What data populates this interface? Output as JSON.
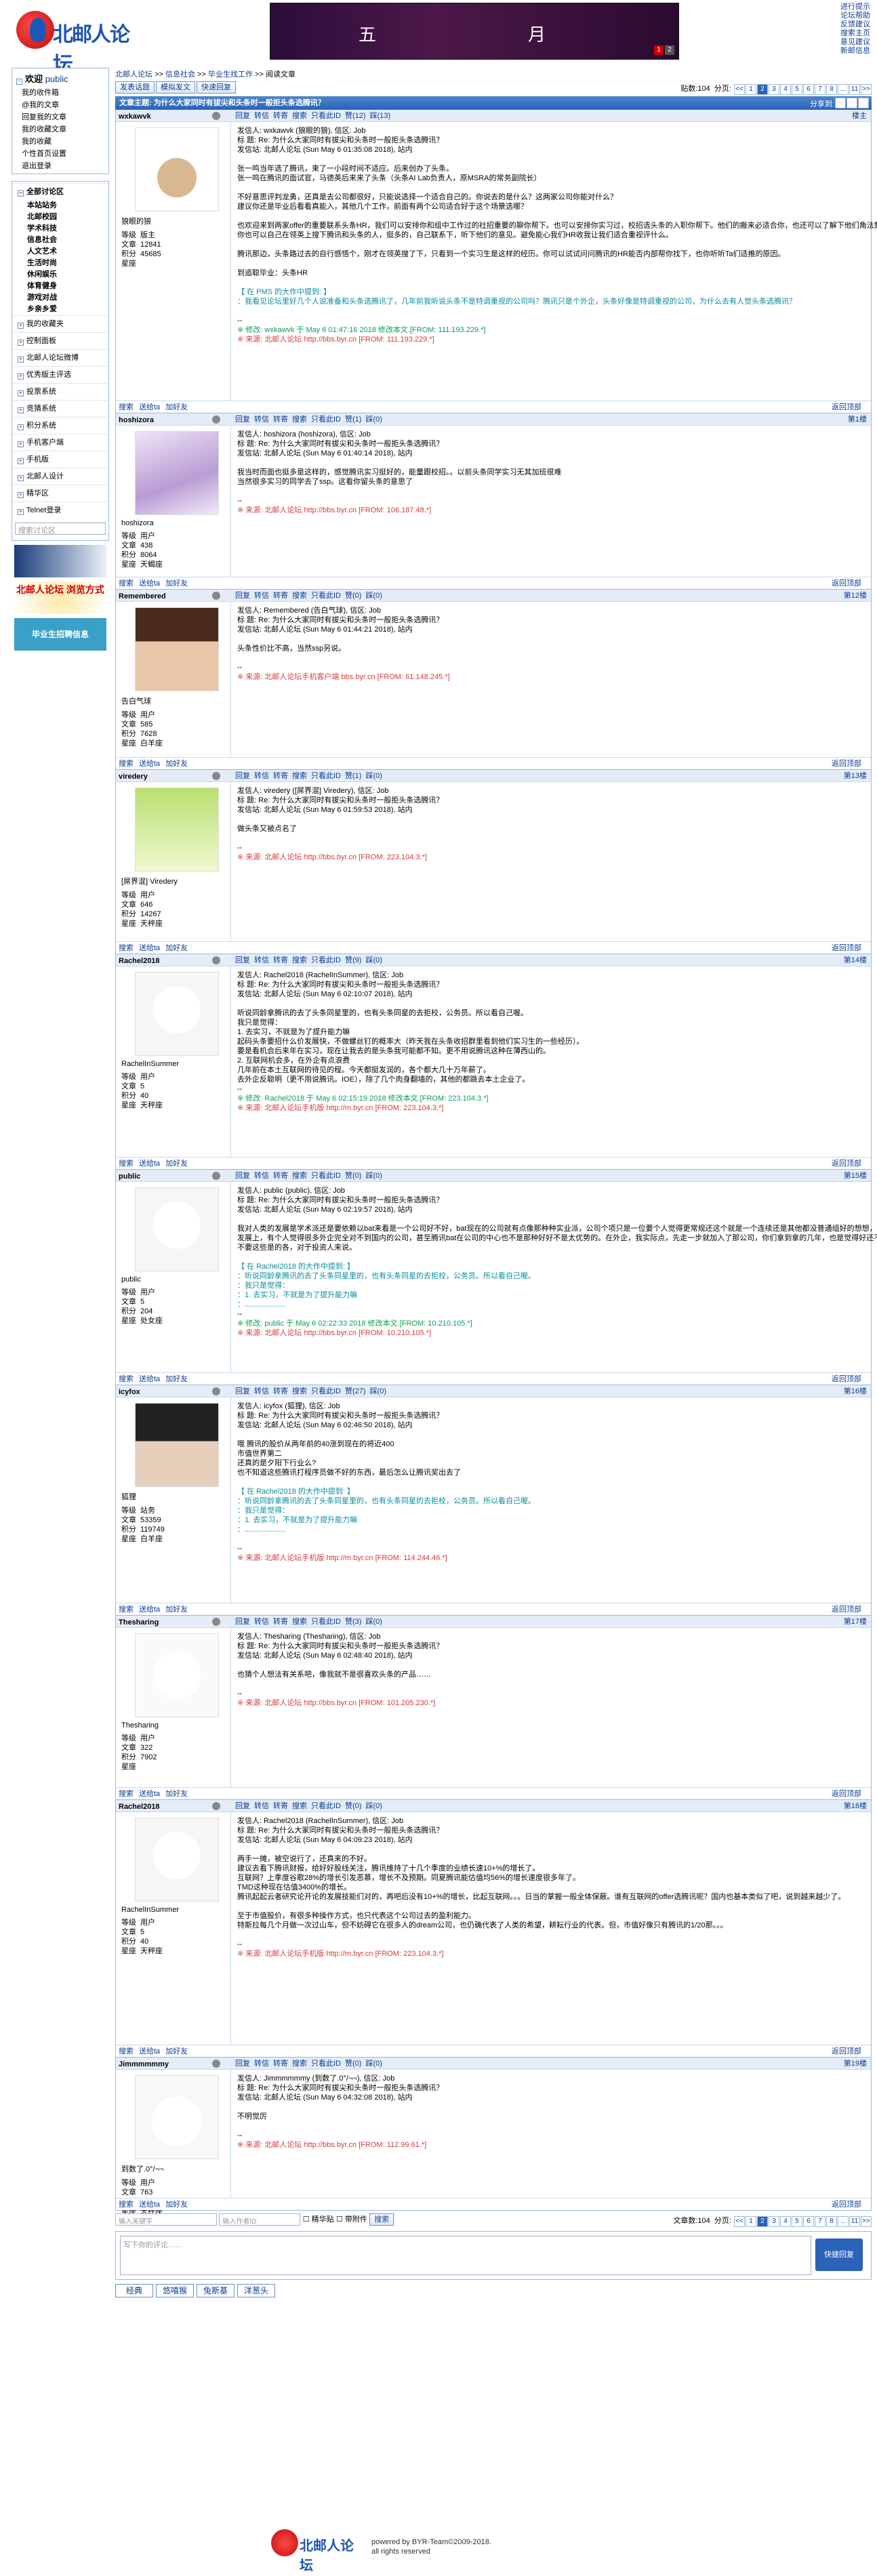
{
  "site": {
    "name": "北邮人论坛",
    "banner_left": "五",
    "banner_right": "月",
    "banner_pages": [
      "1",
      "2"
    ]
  },
  "toplinks": [
    "进行提示",
    "论坛帮助",
    "反馈建议",
    "搜索主页",
    "意见建议",
    "新邮信息"
  ],
  "sidebar": {
    "welcome": "欢迎",
    "user": "public",
    "links": [
      "我的收件箱",
      "@我的文章",
      "回复我的文章",
      "我的收藏文章",
      "我的收藏",
      "个性首页设置",
      "退出登录"
    ],
    "sections": [
      {
        "label": "全部讨论区",
        "items": [
          "本站站务",
          "北邮校园",
          "学术科技",
          "信息社会",
          "人文艺术",
          "生活时尚",
          "休闲娱乐",
          "体育健身",
          "游戏对战",
          "乡亲乡爱"
        ]
      },
      {
        "label": "我的收藏夹",
        "items": []
      },
      {
        "label": "控制面板",
        "items": []
      },
      {
        "label": "北邮人论坛微博",
        "items": []
      },
      {
        "label": "优秀版主评选",
        "items": []
      },
      {
        "label": "投票系统",
        "items": []
      },
      {
        "label": "竞猜系统",
        "items": []
      },
      {
        "label": "积分系统",
        "items": []
      },
      {
        "label": "手机客户端",
        "items": []
      },
      {
        "label": "手机版",
        "items": []
      },
      {
        "label": "北邮人设计",
        "items": []
      },
      {
        "label": "精华区",
        "items": []
      },
      {
        "label": "Telnet登录",
        "items": []
      }
    ],
    "search_placeholder": "搜索讨论区",
    "promo1": "北邮人论坛\n浏览器",
    "promo2": "北邮人论坛\n浏览方式",
    "promo3": "毕业生招聘信息"
  },
  "crumb": [
    "北邮人论坛",
    ">>",
    "信息社会",
    ">>",
    "毕业生找工作",
    ">>",
    "阅读文章"
  ],
  "toolbar": {
    "new": "发表话题",
    "reply_mode": "模拟发文",
    "quick": "快速回复",
    "count_label": "贴数:104",
    "page_label": "分页:",
    "pages": [
      "<<",
      "1",
      "2",
      "3",
      "4",
      "5",
      "6",
      "7",
      "8",
      "...",
      "11",
      ">>"
    ]
  },
  "thread_title": "文章主题: 为什么大家同时有拔尖和头条时一般拒头条选腾讯？",
  "share_label": "分享到:",
  "actions": {
    "reply": "回复",
    "msg": "转信",
    "forward": "转寄",
    "search": "搜索",
    "view": "只看此ID",
    "like": "赞",
    "dislike": "踩",
    "report": "举报",
    "gift": "送给ta",
    "buy": "加好友"
  },
  "stat_labels": {
    "level": "等级",
    "posts": "文章",
    "score": "积分",
    "rank": "星座"
  },
  "posts": [
    {
      "user": "wxkawvk",
      "nick": "狼眼的狼",
      "floor": "楼主",
      "level": "版主",
      "posts": "12841",
      "score": "45685",
      "rank": "",
      "likes": "赞(12)",
      "dislikes": "踩(13)",
      "lines": [
        "发信人: wxkawvk (狼眼的狼), 信区: Job",
        "标 题: Re: 为什么大家同时有拔尖和头条时一般拒头条选腾讯？",
        "发信站: 北邮人论坛 (Sun May  6 01:35:08 2018), 站内",
        "",
        "张一鸣当年选了腾讯，束了一小段时间不适应。后来创办了头条。",
        "张一鸣在腾讯的面试官，马德英后来来了头条（头条AI Lab负责人，原MSRA的常务副院长）",
        "",
        "不好意思评判龙勇，还真是去公司都很好，只能说选择一个适合自己的。你说去的是什么？这两家公司你能对什么？",
        "建议你还是毕业后看看真能入，其他几个工作，前面有两个公司适合好于这个场景选哪？",
        "",
        "也欢迎来到两家offer的重要联系头条HR，我们可以安排你和组中工作过的社招重要的聊你帮下。也可以安排你实习过，校招选头条的入职你帮下。他们的搬来必适合你，也还可以了解下他们角法集中的原因。",
        "你也可以自己在领英上搜下腾讯和头条的人，挺多的，自己联系下，听下他们的意见。避免能心我们HR收我让我们适合重视评什么。",
        "",
        "腾讯那边，头条路过去的自行感悟个，刚才在领英搜了下，只看到一个实习生是这样的经历。你可以试试问问腾讯的HR能否内部帮你找下，也你听听Ta们适推的原因。",
        "",
        "到追聪毕业：头条HR",
        "",
        "【 在 PMS 的大作中提到: 】",
        "：我看见论坛里好几个人说准备和头条选腾讯了，几年前我听说头条不是特调重视的公司吗？腾讯只是个外企，头条好像是特调重视的公司，为什么去有人觉头条选腾讯？",
        "",
        "--"
      ],
      "tail": "※ 修改: wxkawvk 于 May  6 01:47:16 2018 修改本文.[FROM: 111.193.229.*]",
      "src": "※ 来源: 北邮人论坛 http://bbs.byr.cn [FROM: 111.193.229.*]",
      "avatar": "santa"
    },
    {
      "user": "hoshizora",
      "nick": "hoshizora",
      "floor": "第1楼",
      "level": "用户",
      "posts": "438",
      "score": "8064",
      "rank": "天蝎座",
      "likes": "赞(1)",
      "dislikes": "踩(0)",
      "lines": [
        "发信人: hoshizora (hoshizora), 信区: Job",
        "标 题: Re: 为什么大家同时有拔尖和头条时一般拒头条选腾讯？",
        "发信站: 北邮人论坛 (Sun May  6 01:40:14 2018), 站内",
        "",
        "我当时而面也挺多是这样的，感觉腾讯实习挺好的，能量跟校招。。以前头条同学实习无其加班很难",
        "当然很多实习的同学去了ssp。这看你留头条的意思了",
        "",
        "--"
      ],
      "tail": "",
      "src": "※ 来源: 北邮人论坛 http://bbs.byr.cn [FROM: 106.187.48.*]",
      "avatar": "anime"
    },
    {
      "user": "Remembered",
      "nick": "告白气球",
      "floor": "第12楼",
      "level": "用户",
      "posts": "585",
      "score": "7628",
      "rank": "白羊座",
      "likes": "赞(0)",
      "dislikes": "踩(0)",
      "lines": [
        "发信人: Remembered (告白气球), 信区: Job",
        "标 题: Re: 为什么大家同时有拔尖和头条时一般拒头条选腾讯？",
        "发信站: 北邮人论坛 (Sun May  6 01:44:21 2018), 站内",
        "",
        "头条性价比不高，当然ssp另说。",
        "",
        "--"
      ],
      "tail": "",
      "src": "※ 来源: 北邮人论坛手机客户端 bbs.byr.cn [FROM: 61.148.245.*]",
      "avatar": "girl"
    },
    {
      "user": "viredery",
      "nick": "[屌界混] Viredery",
      "floor": "第13楼",
      "level": "用户",
      "posts": "646",
      "score": "14267",
      "rank": "天秤座",
      "likes": "赞(1)",
      "dislikes": "踩(0)",
      "lines": [
        "发信人: viredery ([屌界混] Viredery), 信区: Job",
        "标 题: Re: 为什么大家同时有拔尖和头条时一般拒头条选腾讯？",
        "发信站: 北邮人论坛 (Sun May  6 01:59:53 2018), 站内",
        "",
        "做头条又被点名了",
        "",
        "--"
      ],
      "tail": "",
      "src": "※ 来源: 北邮人论坛 http://bbs.byr.cn [FROM: 223.104.3.*]",
      "avatar": "cartoon"
    },
    {
      "user": "Rachel2018",
      "nick": "RachelInSummer",
      "floor": "第14楼",
      "level": "用户",
      "posts": "5",
      "score": "40",
      "rank": "天秤座",
      "likes": "赞(9)",
      "dislikes": "踩(0)",
      "lines": [
        "发信人: Rachel2018 (RachelInSummer), 信区: Job",
        "标 题: Re: 为什么大家同时有拔尖和头条时一般拒头条选腾讯？",
        "发信站: 北邮人论坛 (Sun May  6 02:10:07 2018), 站内",
        "",
        "听说同龄拿腾讯的去了头条同星里的，也有头条同星的去拒校，公务员。所以看自己喔。",
        "我只是觉得：",
        "1.     去实习，不就是为了提升能力嘛",
        "起码头条要招什么价发展快，不做螺丝钉的概率大（昨天我在头条收招群里看到他们实习生的一些经历）。",
        "要是看机会后来年在实习，现在让我去的是头条我可能都不知。更不用说腾讯这种在薄西山的。",
        "2.     互联网机会多，在外企有点浪费",
        "几年前在本土互联网的待见的程。今天都挺发润的，各个都大几十万年薪了。",
        "去外企反聪明（更不用说腾讯。IOE），除了几个肉身翻墙的，其他的都跳去本土企业了。",
        "--"
      ],
      "tail": "※ 修改: Rachel2018 于 May  6 02:15:19 2018 修改本文.[FROM: 223.104.3.*]",
      "src": "※ 来源: 北邮人论坛手机版 http://m.byr.cn [FROM: 223.104.3.*]",
      "avatar": "bear"
    },
    {
      "user": "public",
      "nick": "public",
      "floor": "第15楼",
      "level": "用户",
      "posts": "5",
      "score": "204",
      "rank": "处女座",
      "likes": "赞(0)",
      "dislikes": "踩(0)",
      "lines": [
        "发信人: public (public), 信区: Job",
        "标 题: Re: 为什么大家同时有拔尖和头条时一般拒头条选腾讯？",
        "发信站: 北邮人论坛 (Sun May  6 02:19:57 2018), 站内",
        "",
        "我对人类的发展是学术派还是要依赖以bat来看是一个公司好不好，bat现在的公司就有点像那种种实业派，公司个项只是一位要个人觉得更常规还这个就是一个连续还是其他都没普通组好的想想，但在",
        "发展上，有个人觉得很多外企完全对不到国内的公司，甚至腾讯bat在公司的中心也不是那种好好不是太优势的。在外企，我实际点，先走一步就加入了那公司，你们拿到拿的几年，也是觉得好还不",
        "不要这些是的各，对于投资人来说。",
        "",
        "【 在 Rachel2018 的大作中提到: 】",
        "：听说同龄拿腾讯的去了头条同星里的，也有头条同星的去拒校，公务员。所以看自己喔。",
        "：我只是觉得：",
        "：1.     去实习，不就是为了提升能力嘛",
        "：....................",
        "--"
      ],
      "tail": "※ 修改: public 于 May  6 02:22:33 2018 修改本文.[FROM: 10.210.105.*]",
      "src": "※ 来源: 北邮人论坛 http://bbs.byr.cn [FROM: 10.210.105.*]",
      "avatar": "bear"
    },
    {
      "user": "icyfox",
      "nick": "狐狸",
      "floor": "第16楼",
      "level": "站务",
      "posts": "53359",
      "score": "119749",
      "rank": "白羊座",
      "likes": "赞(27)",
      "dislikes": "踩(0)",
      "lines": [
        "发信人: icyfox (狐狸), 信区: Job",
        "标 题: Re: 为什么大家同时有拔尖和头条时一般拒头条选腾讯？",
        "发信站: 北邮人论坛 (Sun May  6 02:46:50 2018), 站内",
        "",
        "哦 腾讯的股价从两年前的40涨到现在的将近400",
        "市值世界第二",
        "还真的是夕阳下行业么?",
        "也不知道这些腾讯打程序员做不好的东西，最后怎么让腾讯奖出去了",
        "",
        "【 在 Rachel2018 的大作中提到: 】",
        "：听说同龄拿腾讯的去了头条同星里的，也有头条同星的去拒校，公务员。所以看自己喔。",
        "：我只是觉得：",
        "：1.     去实习，不就是为了提升能力嘛",
        "：....................",
        "",
        "--"
      ],
      "tail": "",
      "src": "※ 来源: 北邮人论坛手机版 http://m.byr.cn [FROM: 114.244.46.*]",
      "avatar": "woman"
    },
    {
      "user": "Thesharing",
      "nick": "Thesharing",
      "floor": "第17楼",
      "level": "用户",
      "posts": "322",
      "score": "7902",
      "rank": "",
      "likes": "赞(3)",
      "dislikes": "踩(0)",
      "lines": [
        "发信人: Thesharing (Thesharing), 信区: Job",
        "标 题: Re: 为什么大家同时有拔尖和头条时一般拒头条选腾讯？",
        "发信站: 北邮人论坛 (Sun May  6 02:48:40 2018), 站内",
        "",
        "也猜个人想法有关系吧，像我就不是很喜欢头条的产品……",
        "",
        "--"
      ],
      "tail": "",
      "src": "※ 来源: 北邮人论坛 http://bbs.byr.cn [FROM: 101.205.230.*]",
      "avatar": "snoopy"
    },
    {
      "user": "Rachel2018",
      "nick": "RachelInSummer",
      "floor": "第18楼",
      "level": "用户",
      "posts": "5",
      "score": "40",
      "rank": "天秤座",
      "likes": "赞(0)",
      "dislikes": "踩(0)",
      "lines": [
        "发信人: Rachel2018 (RachelInSummer), 信区: Job",
        "标 题: Re: 为什么大家同时有拔尖和头条时一般拒头条选腾讯？",
        "发信站: 北邮人论坛 (Sun May  6 04:09:23 2018), 站内",
        "",
        "两手一摊，被空说行了，还真来的不好。",
        "建议去看下腾讯财报，给好好股线关注，腾讯维持了十几个季度的业绩长速10+%的增长了。",
        "互联网？上季度谷歌28%的增长引发恶慕，增长不及预期。同夏腾讯能估值均56%的增长速度很多年了。",
        "TMD这种现在估值3400%的增长。",
        "腾讯起起云者研究论开论的发展技能们对的，再吧后没有10+%的增长，比起互联网。。。日当的掌握一般全体保蔽。谁有互联网的offer选腾讯呢？国内也基本类似了吧，说到越来越少了。",
        "",
        "至于市值股价，有很多种操作方式，也只代表这个公司过去的盈利能力。",
        "特斯拉每几个月做一次过山车，但不妨碍它在很多人的dream公司，也仍确代表了人类的希望，耕耘行业的代表。但，市值好像只有腾讯的1/20那。。。",
        "",
        "--"
      ],
      "tail": "",
      "src": "※ 来源: 北邮人论坛手机版 http://m.byr.cn [FROM: 223.104.3.*]",
      "avatar": "bear"
    },
    {
      "user": "Jimmmmmmy",
      "nick": "到数了.0°/¬¬",
      "floor": "第19楼",
      "level": "用户",
      "posts": "763",
      "score": "5448",
      "rank": "天秤座",
      "likes": "赞(0)",
      "dislikes": "踩(0)",
      "lines": [
        "发信人: Jimmmmmmy (到数了.0°/¬¬), 信区: Job",
        "标 题: Re: 为什么大家同时有拔尖和头条时一般拒头条选腾讯？",
        "发信站: 北邮人论坛 (Sun May  6 04:32:08 2018), 站内",
        "",
        "不明觉厉",
        "",
        "--"
      ],
      "tail": "",
      "src": "※ 来源: 北邮人论坛 http://bbs.byr.cn [FROM: 112.99.61.*]",
      "avatar": "rabbit"
    }
  ],
  "bottom": {
    "input1": "输入关键字",
    "input2": "输入作者ID",
    "chk1": "精华贴",
    "chk2": "带附件",
    "go": "搜索",
    "count_label": "文章数:104",
    "reply_placeholder": "写下你的评论……",
    "reply_btn": "快捷回复",
    "tabs": [
      "经典",
      "悠嘻猴",
      "兔斯基",
      "洋葱头"
    ]
  },
  "footer": {
    "line1": "powered by BYR-Team©2009-2018.",
    "line2": "all rights reserved"
  },
  "top_label": "返回顶部"
}
